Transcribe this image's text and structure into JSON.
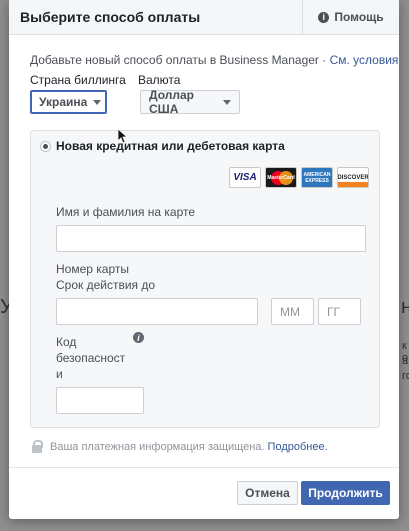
{
  "background": {
    "left_glyph": "У",
    "right_glyph": "н",
    "right_fragments": [
      "к о",
      "а",
      "го"
    ]
  },
  "dialog": {
    "title": "Выберите способ оплаты",
    "help_label": "Помощь",
    "help_icon": "info-icon",
    "intro_text": "Добавьте новый способ оплаты в Business Manager · ",
    "terms_link": "См. условия",
    "country_label": "Страна биллинга",
    "country_value": "Украина",
    "currency_label": "Валюта",
    "currency_value": "Доллар США",
    "card_option_label": "Новая кредитная или дебетовая карта",
    "card_brands": [
      {
        "name": "VISA"
      },
      {
        "name": "MasterCard"
      },
      {
        "name": "AMERICAN EXPRESS"
      },
      {
        "name": "DISCOVER"
      }
    ],
    "cardholder_label": "Имя и фамилия на карте",
    "cardholder_value": "",
    "card_number_label": "Номер карты",
    "expiry_label": "Срок действия до",
    "card_number_value": "",
    "month_placeholder": "ММ",
    "year_placeholder": "ГГ",
    "security_code_label_lines": [
      "Код",
      "безопасност",
      "и"
    ],
    "security_code_value": "",
    "secure_text": "Ваша платежная информация защищена.",
    "secure_link": "Подробнее.",
    "cancel_label": "Отмена",
    "continue_label": "Продолжить"
  },
  "colors": {
    "accent": "#4267b2",
    "link": "#365899",
    "header_bg": "#f5f6f7",
    "panel_bg": "#f6f7f9"
  }
}
